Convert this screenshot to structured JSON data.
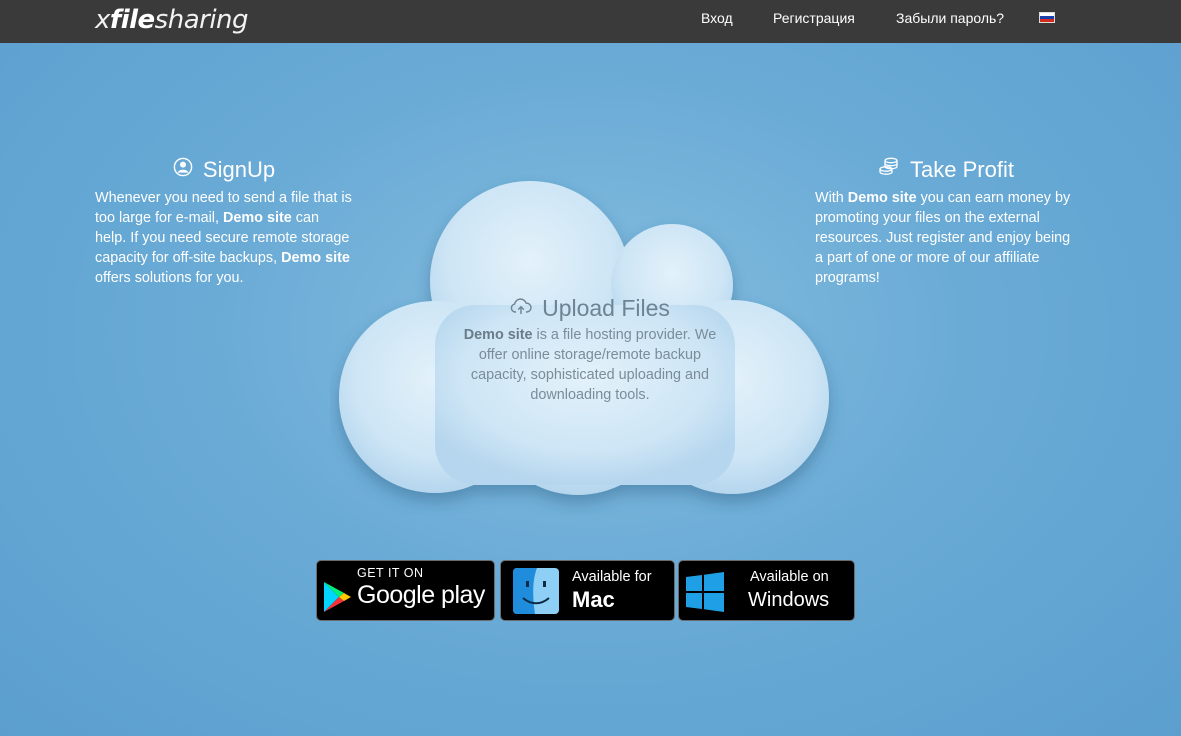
{
  "header": {
    "logo_prefix": "x",
    "logo_bold": "file",
    "logo_suffix": "sharing",
    "nav": {
      "login": "Вход",
      "register": "Регистрация",
      "forgot": "Забыли пароль?"
    },
    "language": "ru"
  },
  "signup": {
    "title": "SignUp",
    "icon": "user-circle-icon",
    "text_1": "Whenever you need to send a file that is too large for e-mail,",
    "site_1": "Demo site",
    "text_2": "can help. If you need secure remote storage capacity for off-site backups,",
    "site_2": "Demo site",
    "text_3": "offers solutions for you."
  },
  "upload": {
    "title": "Upload Files",
    "icon": "cloud-upload-icon",
    "site": "Demo site",
    "text": "is a file hosting provider. We offer online storage/remote backup capacity, sophisticated uploading and downloading tools."
  },
  "profit": {
    "title": "Take Profit",
    "icon": "coins-stack-icon",
    "text_1": "With",
    "site": "Demo site",
    "text_2": "you can earn money by promoting your files on the external resources. Just register and enjoy being a part of one or more of our affiliate programs!"
  },
  "badges": {
    "google": {
      "line1": "GET IT ON",
      "line2": "Google play",
      "icon": "google-play-icon"
    },
    "mac": {
      "line1": "Available for",
      "line2": "Mac",
      "icon": "mac-finder-icon"
    },
    "windows": {
      "line1": "Available on",
      "line2": "Windows",
      "icon": "windows-icon"
    }
  },
  "colors": {
    "topbar": "#3a3a3a",
    "background": "#6aabd6",
    "cloud": "#cfe6f5"
  }
}
